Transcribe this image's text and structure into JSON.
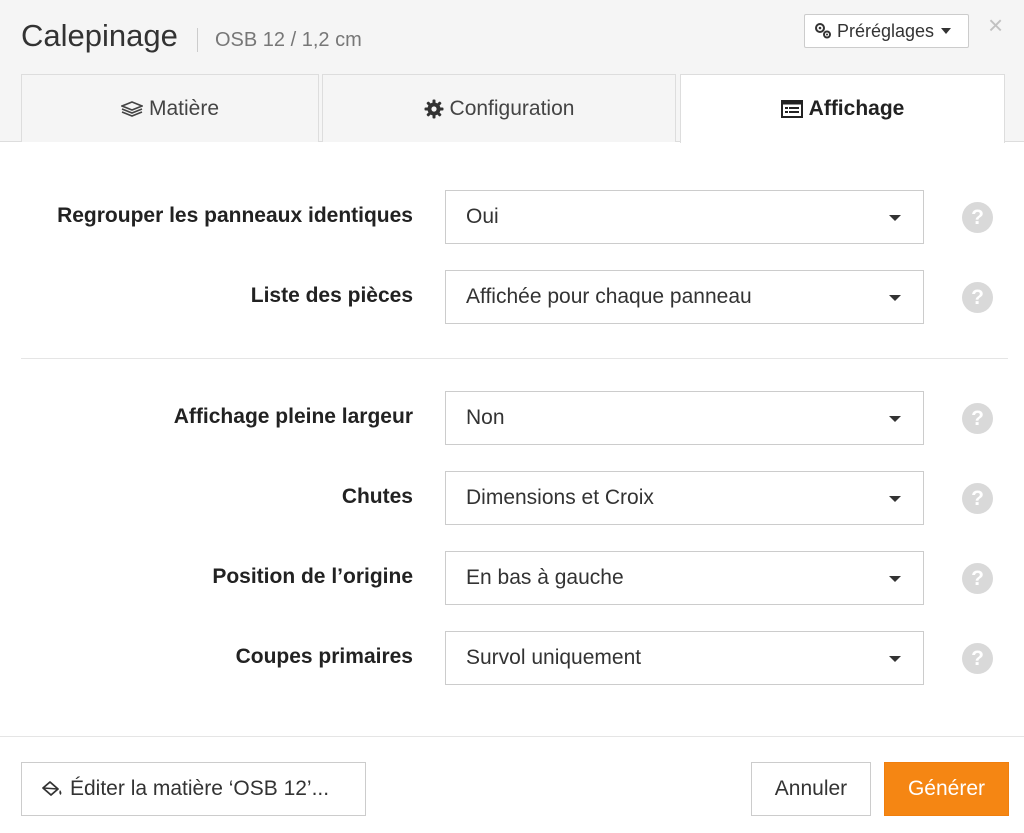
{
  "dialog": {
    "title": "Calepinage",
    "subtitle": "OSB 12 / 1,2 cm",
    "presets_label": "Préréglages",
    "close_glyph": "×"
  },
  "tabs": [
    {
      "label": "Matière",
      "icon": "layers-icon",
      "active": false
    },
    {
      "label": "Configuration",
      "icon": "gear-icon",
      "active": false
    },
    {
      "label": "Affichage",
      "icon": "list-window-icon",
      "active": true
    }
  ],
  "fields": [
    {
      "label": "Regrouper les panneaux identiques",
      "value": "Oui"
    },
    {
      "label": "Liste des pièces",
      "value": "Affichée pour chaque panneau"
    },
    {
      "label": "Affichage pleine largeur",
      "value": "Non"
    },
    {
      "label": "Chutes",
      "value": "Dimensions et Croix"
    },
    {
      "label": "Position de l’origine",
      "value": "En bas à gauche"
    },
    {
      "label": "Coupes primaires",
      "value": "Survol uniquement"
    }
  ],
  "help_glyph": "?",
  "footer": {
    "edit_label": "Éditer la matière ‘OSB 12’...",
    "cancel_label": "Annuler",
    "generate_label": "Générer"
  },
  "colors": {
    "accent": "#f58613",
    "header_bg": "#f5f5f5",
    "help_bg": "#d9d9d9"
  }
}
